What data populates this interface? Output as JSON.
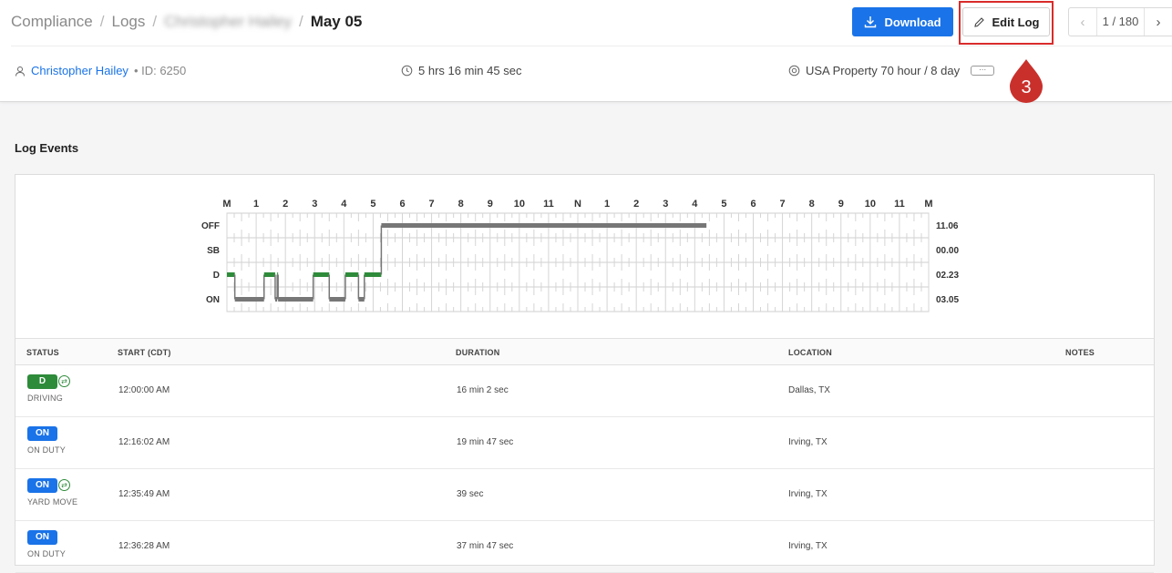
{
  "breadcrumb": {
    "items": [
      "Compliance",
      "Logs",
      "Christopher Hailey"
    ],
    "current": "May 05"
  },
  "toolbar": {
    "download_label": "Download",
    "edit_label": "Edit Log",
    "marker_number": "3"
  },
  "pager": {
    "text": "1 / 180",
    "prev_icon": "chevron-left-icon",
    "next_icon": "chevron-right-icon"
  },
  "info": {
    "driver_name": "Christopher Hailey",
    "driver_id": "• ID: 6250",
    "duration": "5 hrs 16 min 45 sec",
    "ruleset": "USA Property 70 hour / 8 day",
    "more_label": "···"
  },
  "section": {
    "title": "Log Events"
  },
  "chart_data": {
    "type": "line",
    "hour_labels": [
      "M",
      "1",
      "2",
      "3",
      "4",
      "5",
      "6",
      "7",
      "8",
      "9",
      "10",
      "11",
      "N",
      "1",
      "2",
      "3",
      "4",
      "5",
      "6",
      "7",
      "8",
      "9",
      "10",
      "11",
      "M"
    ],
    "status_labels": [
      "OFF",
      "SB",
      "D",
      "ON"
    ],
    "totals": [
      "11.06",
      "00.00",
      "02.23",
      "03.05"
    ],
    "segments": [
      {
        "status": "D",
        "start": 0.0,
        "end": 0.27
      },
      {
        "status": "ON",
        "start": 0.27,
        "end": 1.27
      },
      {
        "status": "D",
        "start": 1.27,
        "end": 1.65
      },
      {
        "status": "ON",
        "start": 1.65,
        "end": 1.72
      },
      {
        "status": "D",
        "start": 1.72,
        "end": 1.75
      },
      {
        "status": "ON",
        "start": 1.75,
        "end": 2.95
      },
      {
        "status": "D",
        "start": 2.95,
        "end": 3.5
      },
      {
        "status": "ON",
        "start": 3.5,
        "end": 4.05
      },
      {
        "status": "D",
        "start": 4.05,
        "end": 4.5
      },
      {
        "status": "ON",
        "start": 4.5,
        "end": 4.7
      },
      {
        "status": "D",
        "start": 4.7,
        "end": 5.28
      },
      {
        "status": "OFF",
        "start": 5.28,
        "end": 16.4
      }
    ],
    "colors": {
      "D": "#2e8b3a",
      "ON": "#777777",
      "OFF": "#777777",
      "SB": "#777777",
      "connector": "#777777"
    }
  },
  "table": {
    "headers": [
      "STATUS",
      "START (CDT)",
      "DURATION",
      "LOCATION",
      "NOTES"
    ],
    "rows": [
      {
        "badge": "D",
        "badge_color": "#2e8b3a",
        "has_icon": true,
        "icon": "transfer-icon",
        "label": "DRIVING",
        "start": "12:00:00 AM",
        "duration": "16 min 2 sec",
        "location": "Dallas, TX"
      },
      {
        "badge": "ON",
        "badge_color": "#1a73e8",
        "has_icon": false,
        "icon": "",
        "label": "ON DUTY",
        "start": "12:16:02 AM",
        "duration": "19 min 47 sec",
        "location": "Irving, TX"
      },
      {
        "badge": "ON",
        "badge_color": "#1a73e8",
        "has_icon": true,
        "icon": "transfer-icon",
        "label": "YARD MOVE",
        "start": "12:35:49 AM",
        "duration": "39 sec",
        "location": "Irving, TX"
      },
      {
        "badge": "ON",
        "badge_color": "#1a73e8",
        "has_icon": false,
        "icon": "",
        "label": "ON DUTY",
        "start": "12:36:28 AM",
        "duration": "37 min 47 sec",
        "location": "Irving, TX"
      }
    ]
  }
}
